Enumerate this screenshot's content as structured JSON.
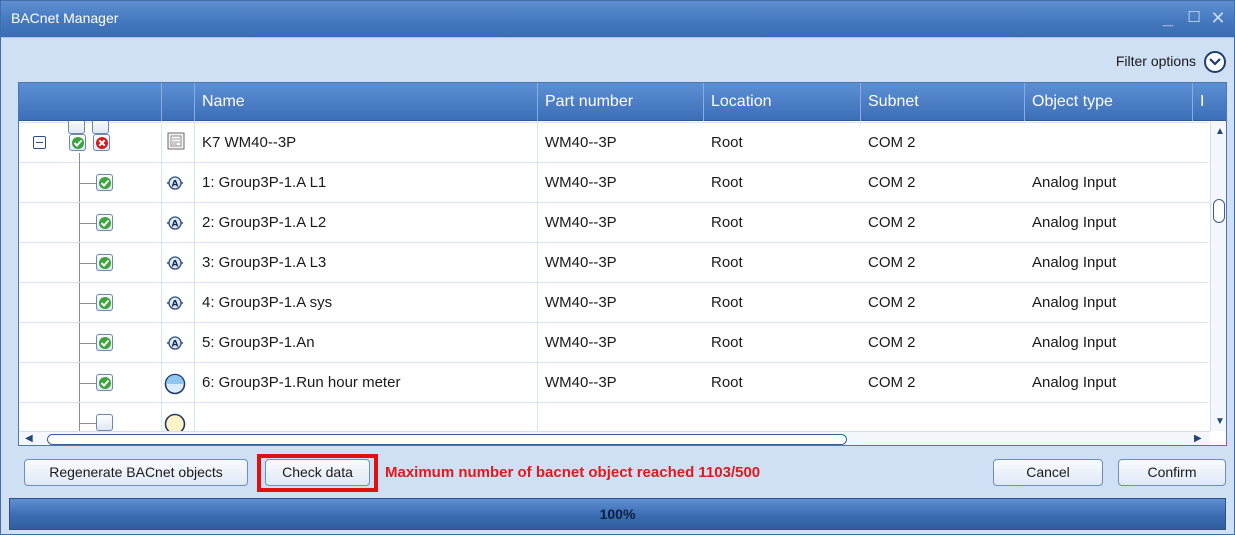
{
  "window": {
    "title": "BACnet Manager",
    "controls": [
      "_",
      "☐",
      "✕"
    ]
  },
  "filter": {
    "label": "Filter options"
  },
  "grid": {
    "columns": [
      "Name",
      "Part number",
      "Location",
      "Subnet",
      "Object type",
      "I"
    ],
    "rows": [
      {
        "name": "K7 WM40--3P",
        "part": "WM40--3P",
        "location": "Root",
        "subnet": "COM 2",
        "type": "",
        "icon": "device-icon"
      },
      {
        "name": "1: Group3P-1.A L1",
        "part": "WM40--3P",
        "location": "Root",
        "subnet": "COM 2",
        "type": "Analog Input",
        "icon": "analog-input-icon"
      },
      {
        "name": "2: Group3P-1.A L2",
        "part": "WM40--3P",
        "location": "Root",
        "subnet": "COM 2",
        "type": "Analog Input",
        "icon": "analog-input-icon"
      },
      {
        "name": "3: Group3P-1.A L3",
        "part": "WM40--3P",
        "location": "Root",
        "subnet": "COM 2",
        "type": "Analog Input",
        "icon": "analog-input-icon"
      },
      {
        "name": "4: Group3P-1.A sys",
        "part": "WM40--3P",
        "location": "Root",
        "subnet": "COM 2",
        "type": "Analog Input",
        "icon": "analog-input-icon"
      },
      {
        "name": "5: Group3P-1.An",
        "part": "WM40--3P",
        "location": "Root",
        "subnet": "COM 2",
        "type": "Analog Input",
        "icon": "analog-input-icon"
      },
      {
        "name": "6: Group3P-1.Run hour meter",
        "part": "WM40--3P",
        "location": "Root",
        "subnet": "COM 2",
        "type": "Analog Input",
        "icon": "meter-icon"
      }
    ]
  },
  "actions": {
    "regenerate": "Regenerate BACnet objects",
    "check": "Check data",
    "warning": "Maximum number of bacnet object reached 1103/500",
    "cancel": "Cancel",
    "confirm": "Confirm"
  },
  "progress": {
    "text": "100%",
    "value": 100
  },
  "colors": {
    "accent": "#3c6fb8",
    "warning": "#e41818",
    "check": "#2f9b2f",
    "error": "#d01c1c"
  }
}
